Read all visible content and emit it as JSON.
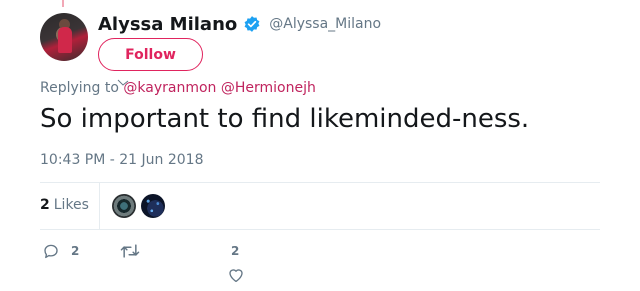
{
  "author": {
    "display_name": "Alyssa Milano",
    "handle": "@Alyssa_Milano",
    "verified": true
  },
  "follow_button": {
    "label": "Follow"
  },
  "replying_to": {
    "prefix": "Replying to",
    "mentions": [
      "@kayranmon",
      "@Hermionejh"
    ]
  },
  "tweet": {
    "text": "So important to find likeminded-ness.",
    "timestamp": "10:43 PM - 21 Jun 2018"
  },
  "stats": {
    "likes_count": "2",
    "likes_label": "Likes"
  },
  "actions": {
    "reply_count": "2",
    "like_count": "2"
  },
  "colors": {
    "accent": "#e0245e",
    "verified": "#1da1f2",
    "muted": "#657786",
    "text": "#14171a",
    "divider": "#e6ecf0"
  },
  "icons": [
    "verified-badge-icon",
    "reply-icon",
    "retweet-icon",
    "heart-icon"
  ]
}
